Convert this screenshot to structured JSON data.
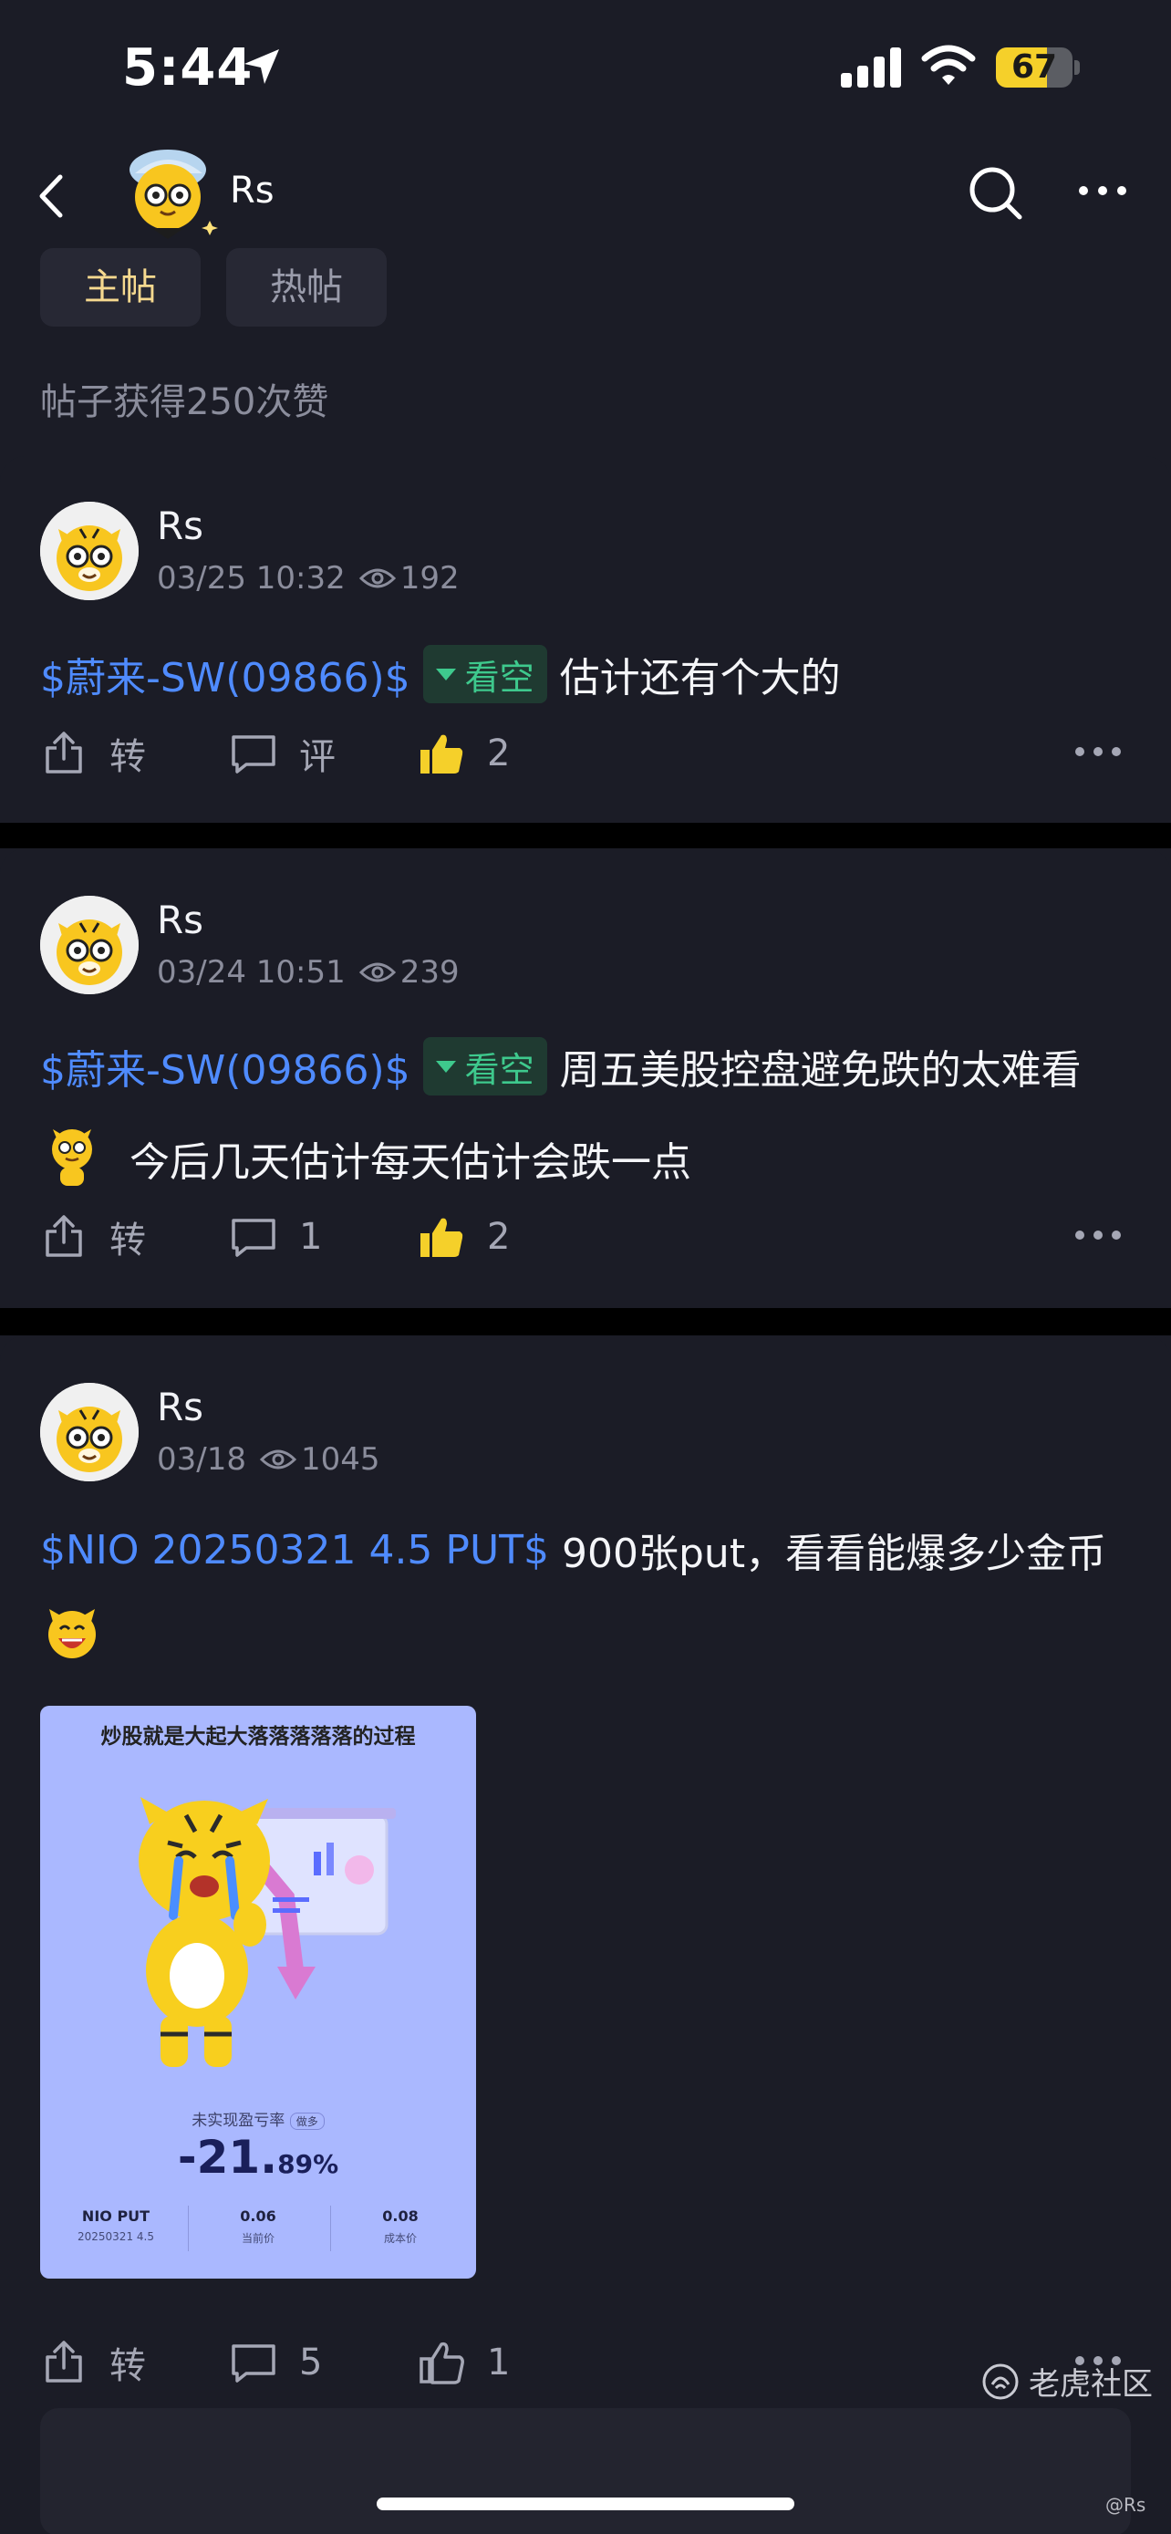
{
  "status_bar": {
    "time": "5:44",
    "battery": "67",
    "battery_level": 0.67
  },
  "header": {
    "name": "Rs",
    "icons": [
      "back-icon",
      "search-icon",
      "more-icon"
    ]
  },
  "tabs": {
    "main": "主帖",
    "hot": "热帖"
  },
  "likes_summary": "帖子获得250次赞",
  "posts": [
    {
      "author": "Rs",
      "date": "03/25 10:32",
      "views": "192",
      "ticker": "$蔚来-SW(09866)$",
      "tag": "看空",
      "text": "估计还有个大的",
      "share": "转",
      "comment": "评",
      "likes": "2",
      "liked": true
    },
    {
      "author": "Rs",
      "date": "03/24 10:51",
      "views": "239",
      "ticker": "$蔚来-SW(09866)$",
      "tag": "看空",
      "text": "周五美股控盘避免跌的太难看",
      "line2": "今后几天估计每天估计会跌一点",
      "share": "转",
      "comment": "1",
      "likes": "2",
      "liked": true
    },
    {
      "author": "Rs",
      "date": "03/18",
      "views": "1045",
      "ticker": "$NIO 20250321 4.5 PUT$",
      "text": "900张put，看看能爆多少金币",
      "image": {
        "title": "炒股就是大起大落落落落落的过程",
        "label": "未实现盈亏率",
        "badge": "做多",
        "pct_main": "-21.",
        "pct_dec": "89%",
        "col1_value": "NIO PUT",
        "col1_label": "20250321  4.5",
        "col2_value": "0.06",
        "col2_label": "当前价",
        "col3_value": "0.08",
        "col3_label": "成本价"
      },
      "share": "转",
      "comment": "5",
      "likes": "1",
      "liked": false
    }
  ],
  "watermark": {
    "brand": "老虎社区",
    "handle": "@Rs"
  },
  "colors": {
    "background": "#1b1c26",
    "ticker": "#4f8bff",
    "bear_tag": "#3ec98d",
    "like": "#f5d02a",
    "tab_active": "#f6d98f"
  }
}
